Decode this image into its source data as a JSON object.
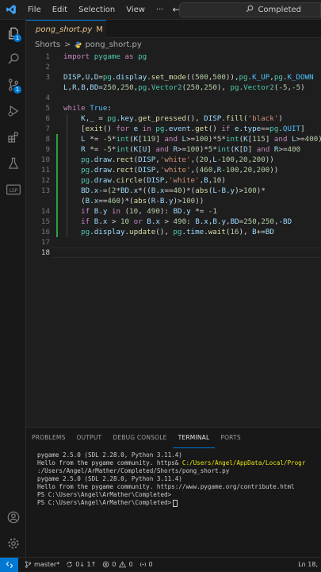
{
  "menu": {
    "file": "File",
    "edit": "Edit",
    "selection": "Selection",
    "view": "View",
    "more": "···"
  },
  "search": {
    "text": "Completed"
  },
  "tab": {
    "name": "pong_short.py",
    "status": "M"
  },
  "breadcrumb": {
    "folder": "Shorts",
    "sep": ">",
    "file": "pong_short.py"
  },
  "activity": {
    "explorer_badge": "1",
    "scm_badge": "1"
  },
  "code_lines": [
    {
      "n": "1",
      "html": "<span class='kw'>import</span> <span class='bi'>pygame</span> <span class='kw'>as</span> <span class='bi'>pg</span>"
    },
    {
      "n": "2",
      "html": ""
    },
    {
      "n": "3",
      "html": "<span class='var'>DISP</span>,<span class='var'>U</span>,<span class='var'>D</span>=<span class='bi'>pg</span>.<span class='var'>display</span>.<span class='fn'>set_mode</span>((<span class='num'>500</span>,<span class='num'>500</span>)),<span class='bi'>pg</span>.<span class='cst'>K_UP</span>,<span class='bi'>pg</span>.<span class='cst'>K_DOWN</span>"
    },
    {
      "n": "",
      "html": "<span class='var'>L</span>,<span class='var'>R</span>,<span class='var'>B</span>,<span class='var'>BD</span>=<span class='num'>250</span>,<span class='num'>250</span>,<span class='bi'>pg</span>.<span class='bi'>Vector2</span>(<span class='num'>250</span>,<span class='num'>250</span>), <span class='bi'>pg</span>.<span class='bi'>Vector2</span>(<span class='num'>-5</span>,<span class='num'>-5</span>)"
    },
    {
      "n": "4",
      "html": ""
    },
    {
      "n": "5",
      "html": "<span class='kw'>while</span> <span class='cst'>True</span>:"
    },
    {
      "n": "6",
      "html": "    <span class='var'>K</span>,<span class='var'>_</span> = <span class='bi'>pg</span>.<span class='var'>key</span>.<span class='fn'>get_pressed</span>(), <span class='var'>DISP</span>.<span class='fn'>fill</span>(<span class='str'>'black'</span>)"
    },
    {
      "n": "7",
      "html": "    [<span class='fn'>exit</span>() <span class='kw'>for</span> <span class='var'>e</span> <span class='kw'>in</span> <span class='bi'>pg</span>.<span class='var'>event</span>.<span class='fn'>get</span>() <span class='kw'>if</span> <span class='var'>e</span>.<span class='var'>type</span>==<span class='bi'>pg</span>.<span class='cst'>QUIT</span>]"
    },
    {
      "n": "8",
      "html": "    <span class='var'>L</span> *= <span class='num'>-5</span>*<span class='bi'>int</span>(<span class='var'>K</span>[<span class='num'>119</span>] <span class='kw'>and</span> <span class='var'>L</span>>=<span class='num'>100</span>)*<span class='num'>5</span>*<span class='bi'>int</span>(<span class='var'>K</span>[<span class='num'>115</span>] <span class='kw'>and</span> <span class='var'>L</span>>=<span class='num'>400</span>)"
    },
    {
      "n": "9",
      "html": "    <span class='var'>R</span> *= <span class='num'>-5</span>*<span class='bi'>int</span>(<span class='var'>K</span>[<span class='var'>U</span>] <span class='kw'>and</span> <span class='var'>R</span>>=<span class='num'>100</span>)*<span class='num'>5</span>*<span class='bi'>int</span>(<span class='var'>K</span>[<span class='var'>D</span>] <span class='kw'>and</span> <span class='var'>R</span>>=<span class='num'>400</span>"
    },
    {
      "n": "10",
      "html": "    <span class='bi'>pg</span>.<span class='var'>draw</span>.<span class='fn'>rect</span>(<span class='var'>DISP</span>,<span class='str'>'white'</span>,(<span class='num'>20</span>,<span class='var'>L</span><span class='num'>-100</span>,<span class='num'>20</span>,<span class='num'>200</span>))"
    },
    {
      "n": "11",
      "html": "    <span class='bi'>pg</span>.<span class='var'>draw</span>.<span class='fn'>rect</span>(<span class='var'>DISP</span>,<span class='str'>'white'</span>,(<span class='num'>460</span>,<span class='var'>R</span><span class='num'>-100</span>,<span class='num'>20</span>,<span class='num'>200</span>))"
    },
    {
      "n": "12",
      "html": "    <span class='bi'>pg</span>.<span class='var'>draw</span>.<span class='fn'>circle</span>(<span class='var'>DISP</span>,<span class='str'>'white'</span>,<span class='var'>B</span>,<span class='num'>10</span>)"
    },
    {
      "n": "13",
      "html": "    <span class='var'>BD</span>.<span class='var'>x</span>-=(<span class='num'>2</span>*<span class='var'>BD</span>.<span class='var'>x</span>*((<span class='var'>B</span>.<span class='var'>x</span>==<span class='num'>40</span>)*(<span class='fn'>abs</span>(<span class='var'>L</span>-<span class='var'>B</span>.<span class='var'>y</span>)><span class='num'>100</span>)*"
    },
    {
      "n": "",
      "html": "    (<span class='var'>B</span>.<span class='var'>x</span>==<span class='num'>460</span>)*(<span class='fn'>abs</span>(<span class='var'>R</span>-<span class='var'>B</span>.<span class='var'>y</span>)><span class='num'>100</span>))"
    },
    {
      "n": "14",
      "html": "    <span class='kw'>if</span> <span class='var'>B</span>.<span class='var'>y</span> <span class='kw'>in</span> (<span class='num'>10</span>, <span class='num'>490</span>): <span class='var'>BD</span>.<span class='var'>y</span> *= <span class='num'>-1</span>"
    },
    {
      "n": "15",
      "html": "    <span class='kw'>if</span> <span class='var'>B</span>.<span class='var'>x</span> > <span class='num'>10</span> <span class='kw'>or</span> <span class='var'>B</span>.<span class='var'>x</span> > <span class='num'>490</span>: <span class='var'>B</span>.<span class='var'>x</span>,<span class='var'>B</span>.<span class='var'>y</span>,<span class='var'>BD</span>=<span class='num'>250</span>,<span class='num'>250</span>,<span class='var'>-BD</span>"
    },
    {
      "n": "16",
      "html": "    <span class='bi'>pg</span>.<span class='var'>display</span>.<span class='fn'>update</span>(), <span class='bi'>pg</span>.<span class='var'>time</span>.<span class='fn'>wait</span>(<span class='num'>16</span>), <span class='var'>B</span>+=<span class='var'>BD</span>"
    }
  ],
  "line_numbers_display": [
    "1",
    "2",
    "3",
    "4",
    "5",
    "6",
    "7",
    "8",
    "9",
    "10",
    "11",
    "12",
    "13",
    "14",
    "15",
    "16",
    "17",
    "18"
  ],
  "panel": {
    "tabs": [
      "PROBLEMS",
      "OUTPUT",
      "DEBUG CONSOLE",
      "TERMINAL",
      "PORTS"
    ],
    "active": "TERMINAL"
  },
  "terminal_lines": [
    "pygame 2.5.0 (SDL 2.28.0, Python 3.11.4)",
    "Hello from the pygame community. https& C:/Users/Angel/AppData/Local/Progr",
    ":/Users/Angel/ArMather/Completed/Shorts/pong_short.py",
    "pygame 2.5.0 (SDL 2.28.0, Python 3.11.4)",
    "Hello from the pygame community. https://www.pygame.org/contribute.html",
    "PS C:\\Users\\Angel\\ArMather\\Completed>",
    "PS C:\\Users\\Angel\\ArMather\\Completed>"
  ],
  "status": {
    "branch": "master*",
    "sync": "0↓ 1↑",
    "errors": "0",
    "warnings": "0",
    "ports": "0",
    "position": "Ln 18,"
  }
}
